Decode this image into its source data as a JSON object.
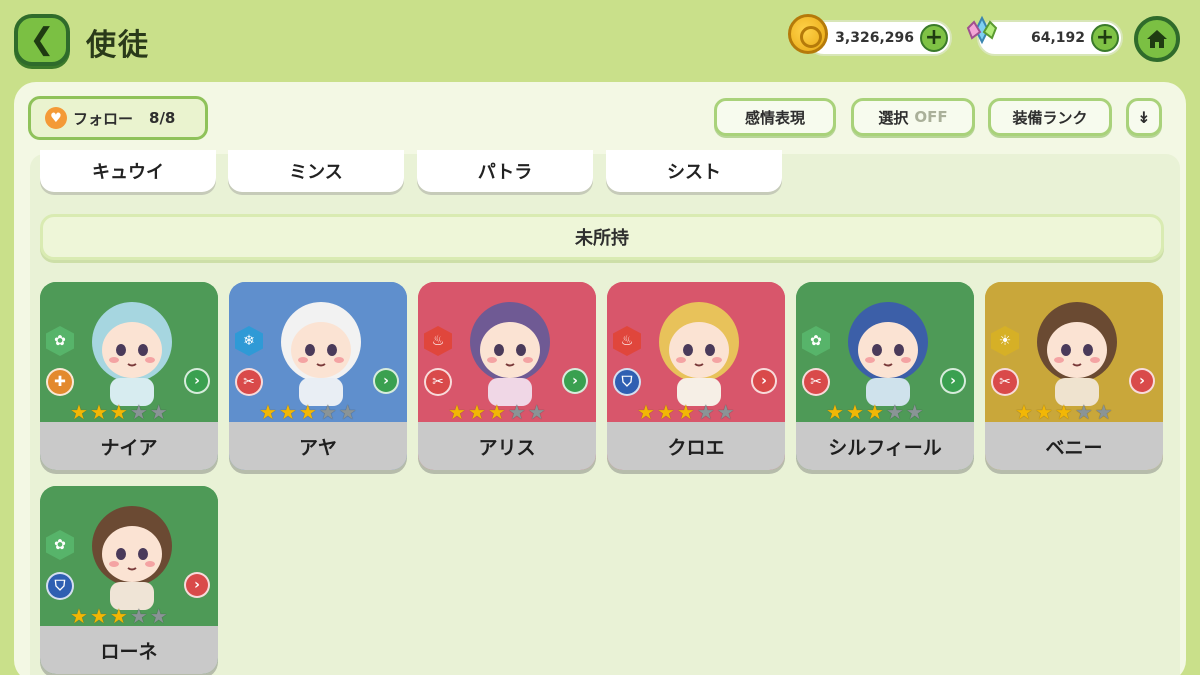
{
  "header": {
    "title": "使徒",
    "gold": "3,326,296",
    "gems": "64,192"
  },
  "toolbar": {
    "follow_label": "フォロー",
    "follow_count": "8/8",
    "emotion_label": "感情表現",
    "select_label": "選択",
    "select_state": "OFF",
    "rank_label": "装備ランク"
  },
  "owned_row": [
    "キュウイ",
    "ミンス",
    "パトラ",
    "シスト"
  ],
  "section": {
    "label": "未所持"
  },
  "characters": [
    {
      "name": "ナイア",
      "stars": 3,
      "card_color": "#4e9a57",
      "element": "nature",
      "element_color": "#57b46a",
      "role": "support",
      "role_color": "#e38a2e",
      "arrow_color": "#3aa050",
      "art_color": "#d7ecf0",
      "hair": "#a6d6e0"
    },
    {
      "name": "アヤ",
      "stars": 3,
      "card_color": "#5f8fcd",
      "element": "ice",
      "element_color": "#2f9ad6",
      "role": "attack",
      "role_color": "#d94a4a",
      "arrow_color": "#3aa050",
      "art_color": "#e9eef4",
      "hair": "#f2f2f2"
    },
    {
      "name": "アリス",
      "stars": 3,
      "card_color": "#d8566b",
      "element": "fire",
      "element_color": "#e0463c",
      "role": "attack",
      "role_color": "#d94a4a",
      "arrow_color": "#3aa050",
      "art_color": "#f0d7e6",
      "hair": "#6f5a94"
    },
    {
      "name": "クロエ",
      "stars": 3,
      "card_color": "#d8566b",
      "element": "fire",
      "element_color": "#e0463c",
      "role": "defense",
      "role_color": "#2f5fb2",
      "arrow_color": "#d94a4a",
      "art_color": "#f6efe6",
      "hair": "#e8c25a"
    },
    {
      "name": "シルフィール",
      "stars": 3,
      "card_color": "#4e9a57",
      "element": "nature",
      "element_color": "#57b46a",
      "role": "attack",
      "role_color": "#d94a4a",
      "arrow_color": "#3aa050",
      "art_color": "#cfe2ec",
      "hair": "#3c5fa8"
    },
    {
      "name": "ベニー",
      "stars": 3,
      "card_color": "#c9a73a",
      "element": "light",
      "element_color": "#d6b026",
      "role": "attack",
      "role_color": "#d94a4a",
      "arrow_color": "#d94a4a",
      "art_color": "#efe3cf",
      "hair": "#6a4a32"
    },
    {
      "name": "ローネ",
      "stars": 3,
      "card_color": "#4e9a57",
      "element": "nature",
      "element_color": "#57b46a",
      "role": "defense",
      "role_color": "#2f5fb2",
      "arrow_color": "#d94a4a",
      "art_color": "#efe4d6",
      "hair": "#6b4a33"
    }
  ],
  "icons": {
    "back": "back-arrow-icon",
    "coin": "gold-coin-icon",
    "gem": "crystal-gem-icon",
    "home": "home-icon",
    "follow": "heart-icon",
    "collapse": "double-chevron-down-icon"
  }
}
